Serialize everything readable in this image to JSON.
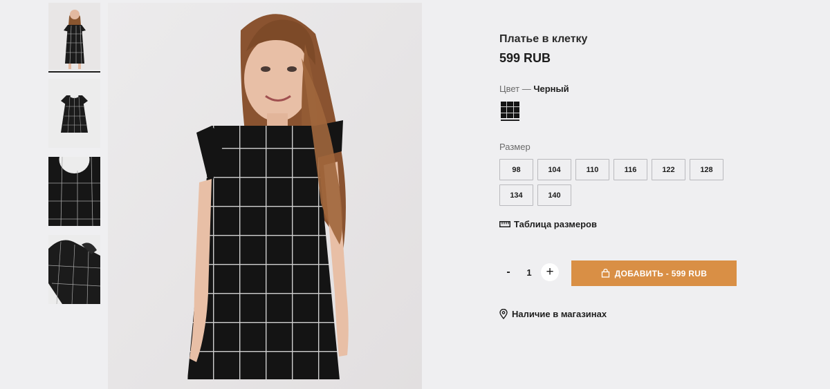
{
  "product": {
    "title": "Платье в клетку",
    "price": "599 RUB"
  },
  "color": {
    "label": "Цвет — ",
    "value": "Черный",
    "swatch_color": "#141414"
  },
  "size": {
    "label": "Размер",
    "options": [
      "98",
      "104",
      "110",
      "116",
      "122",
      "128",
      "134",
      "140"
    ]
  },
  "size_table": {
    "label": "Таблица размеров",
    "icon": "ruler-icon"
  },
  "quantity": {
    "minus": "-",
    "value": "1",
    "plus": "+"
  },
  "add_to_cart": {
    "label": "ДОБАВИТЬ - 599 RUB",
    "icon": "bag-icon",
    "color": "#d98f45"
  },
  "stores": {
    "label": "Наличие в магазинах",
    "icon": "location-pin-icon"
  },
  "gallery": {
    "thumbnails": [
      "thumbnail-full-model",
      "thumbnail-flat-dress",
      "thumbnail-collar-detail",
      "thumbnail-ruffle-detail"
    ],
    "active_index": 0
  }
}
